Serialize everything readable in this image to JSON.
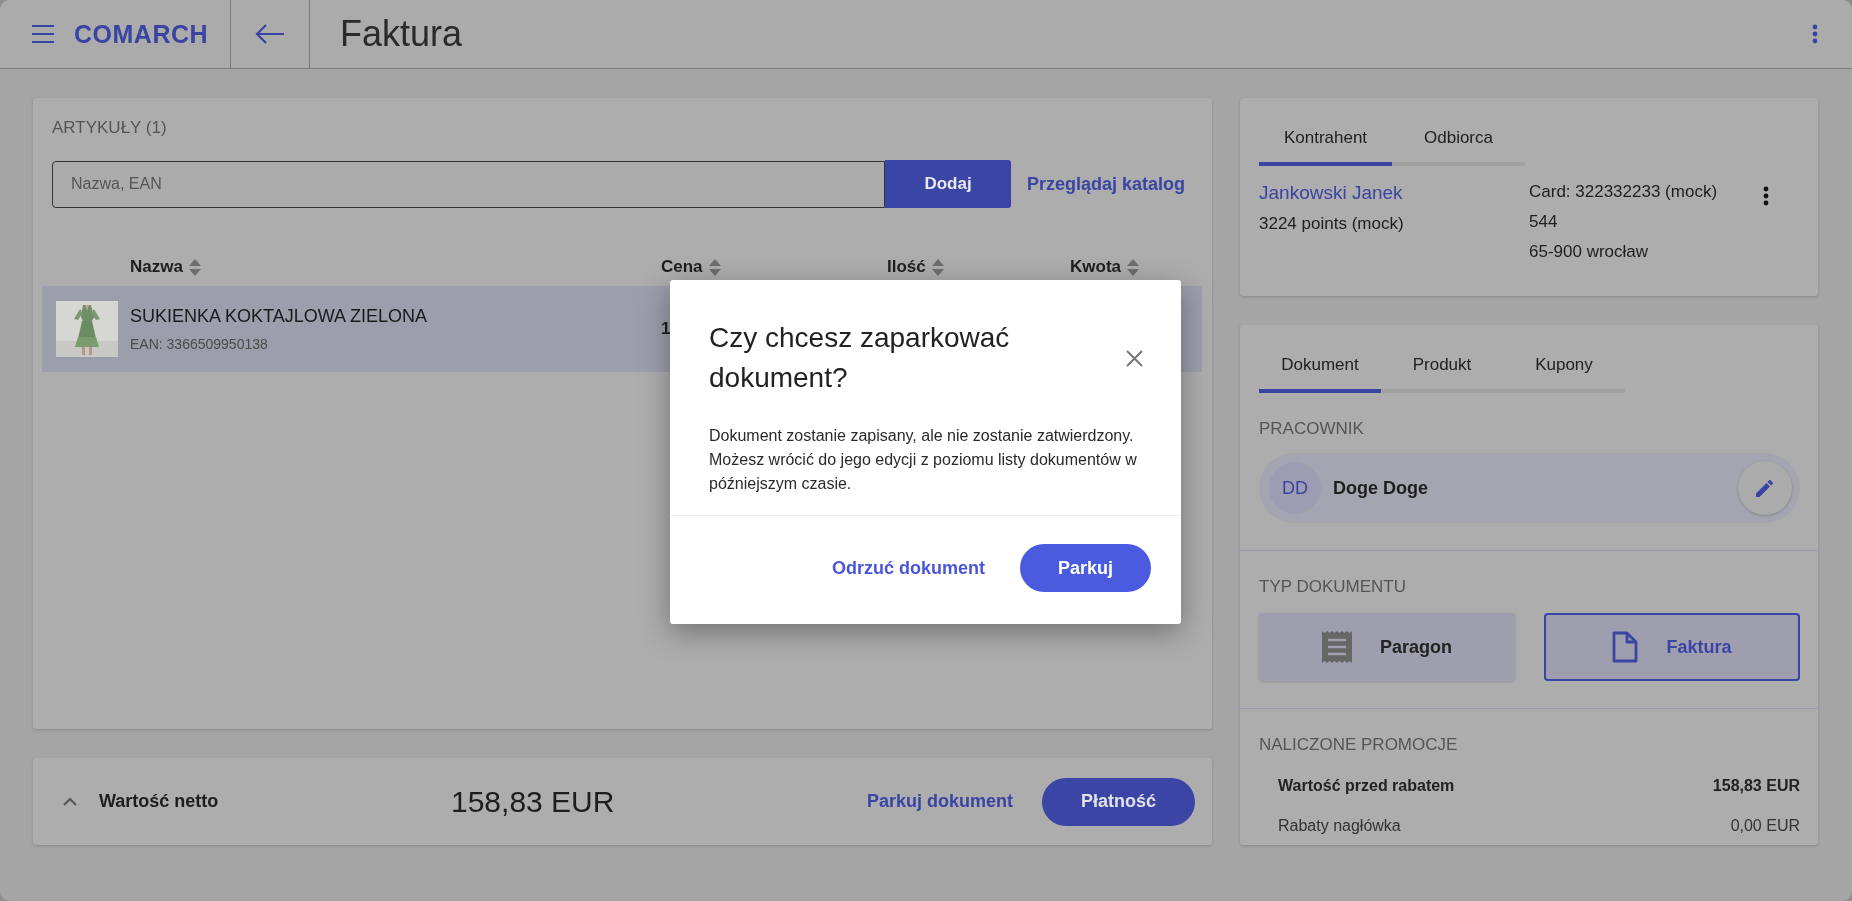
{
  "header": {
    "logo": "COMARCH",
    "title": "Faktura"
  },
  "articles": {
    "heading": "ARTYKUŁY (1)",
    "search": {
      "placeholder": "Nazwa, EAN"
    },
    "add_button": "Dodaj",
    "catalog_link": "Przeglądaj katalog",
    "columns": [
      {
        "label": "Nazwa"
      },
      {
        "label": "Cena"
      },
      {
        "label": "Ilość"
      },
      {
        "label": "Kwota"
      }
    ],
    "rows": [
      {
        "name": "SUKIENKA KOKTAJLOWA ZIELONA",
        "ean": "EAN: 3366509950138",
        "price": "1",
        "selected": true
      }
    ]
  },
  "footer": {
    "label": "Wartość netto",
    "total": "158,83 EUR",
    "park_link": "Parkuj dokument",
    "pay_button": "Płatność"
  },
  "customer": {
    "tabs": [
      {
        "label": "Kontrahent",
        "selected": true
      },
      {
        "label": "Odbiorca",
        "selected": false
      }
    ],
    "name": "Jankowski Janek",
    "points": "3224 points (mock)",
    "details": [
      "Card: 322332233 (mock)",
      "544",
      "65-900 wrocław"
    ]
  },
  "document": {
    "tabs": [
      {
        "label": "Dokument",
        "selected": true
      },
      {
        "label": "Produkt",
        "selected": false
      },
      {
        "label": "Kupony",
        "selected": false
      }
    ],
    "employee_heading": "PRACOWNIK",
    "employee": {
      "initials": "DD",
      "name": "Doge Doge"
    },
    "type_heading": "TYP DOKUMENTU",
    "types": [
      {
        "label": "Paragon",
        "kind": "receipt",
        "selected": false
      },
      {
        "label": "Faktura",
        "kind": "invoice",
        "selected": true
      }
    ],
    "promo_heading": "NALICZONE PROMOCJE",
    "promos": [
      {
        "label": "Wartość przed rabatem",
        "value": "158,83 EUR",
        "bold": true
      },
      {
        "label": "Rabaty nagłówka",
        "value": "0,00 EUR",
        "bold": false
      }
    ]
  },
  "dialog": {
    "title": "Czy chcesz zaparkować dokument?",
    "message": "Dokument zostanie zapisany, ale nie zostanie zatwierdzony. Możesz wrócić do jego edycji z poziomu listy dokumentów w późniejszym czasie.",
    "secondary": "Odrzuć dokument",
    "primary": "Parkuj"
  }
}
